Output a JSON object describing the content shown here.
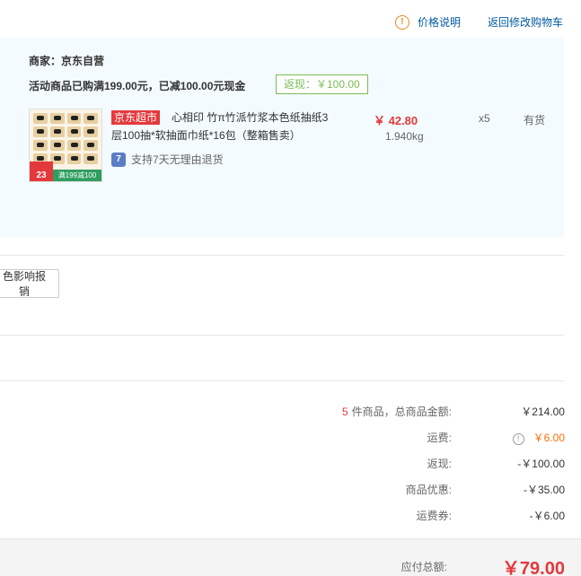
{
  "top_links": {
    "price_note": "价格说明",
    "back_to_cart": "返回修改购物车"
  },
  "shop": {
    "seller": "商家：京东自营",
    "promo": "活动商品已购满199.00元，已减100.00元现金",
    "rebate_tag": "返现：￥100.00"
  },
  "product": {
    "badge": "京东超市",
    "title_line1": "心相印 竹π竹派竹浆本色纸抽纸3",
    "title_line2": "层100抽*软抽面巾纸*16包（整箱售卖）",
    "unit_price": "￥ 42.80",
    "weight": "1.940kg",
    "quantity": "x5",
    "stock": "有货",
    "refund_policy": "支持7天无理由退货",
    "refund_icon_glyph": "7",
    "image_price": "23",
    "image_banner": "满199减100"
  },
  "invoice": {
    "report_button": "色影响报销"
  },
  "summary": {
    "item_count": "5",
    "item_count_suffix": " 件商品，总商品金额:",
    "goods_total": "￥214.00",
    "shipping_label": "运费:",
    "shipping_value": "￥6.00",
    "rebate_label": "返现:",
    "rebate_value": "-￥100.00",
    "discount_label": "商品优惠:",
    "discount_value": "-￥35.00",
    "shipping_coupon_label": "运费券:",
    "shipping_coupon_value": "-￥6.00"
  },
  "total": {
    "label": "应付总额:",
    "value": "￥79.00"
  },
  "colors": {
    "price_red": "#e4393c",
    "link_blue": "#005aa0",
    "shop_bg": "#f3fbfe",
    "rebate_green": "#7abd54",
    "shipping_orange": "#ff6c00"
  },
  "icons": {
    "price_note_icon": "warning-circle-icon",
    "refund_icon": "seven-day-return-icon",
    "shipping_info_icon": "info-circle-icon"
  }
}
